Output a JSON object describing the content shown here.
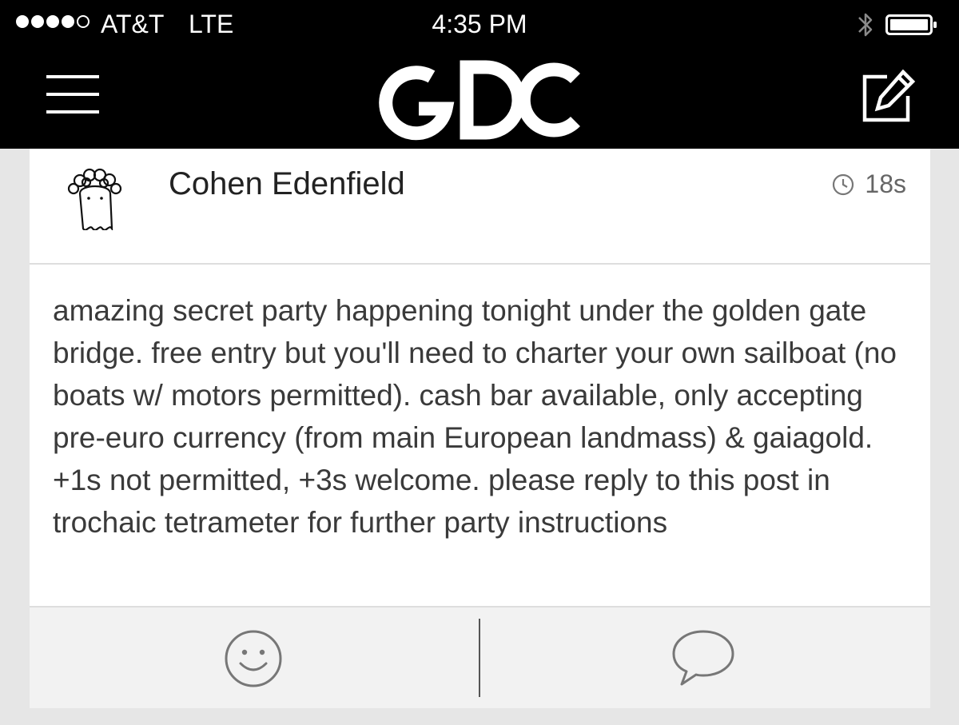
{
  "status_bar": {
    "signal_bars_filled": 4,
    "signal_bars_total": 5,
    "carrier": "AT&T",
    "network": "LTE",
    "time": "4:35 PM"
  },
  "nav": {
    "logo_text": "GDC",
    "menu_icon": "hamburger-menu-icon",
    "compose_icon": "compose-icon"
  },
  "post": {
    "author": "Cohen Edenfield",
    "avatar_icon": "ghost-avatar",
    "timestamp": "18s",
    "body": "amazing secret party happening tonight under the golden gate bridge. free entry but you'll need to charter your own sailboat (no boats w/ motors permitted). cash bar available, only accepting pre-euro currency (from main European landmass) & gaiagold. +1s not permitted, +3s welcome. please reply to this post in trochaic tetrameter for further party instructions",
    "actions": {
      "react_icon": "smiley-icon",
      "reply_icon": "speech-bubble-icon"
    }
  },
  "colors": {
    "status_bg": "#000000",
    "nav_bg": "#000000",
    "page_bg": "#e6e6e6",
    "card_bg": "#ffffff",
    "footer_bg": "#f2f2f2",
    "text": "#3a3a3a",
    "muted": "#666666"
  }
}
